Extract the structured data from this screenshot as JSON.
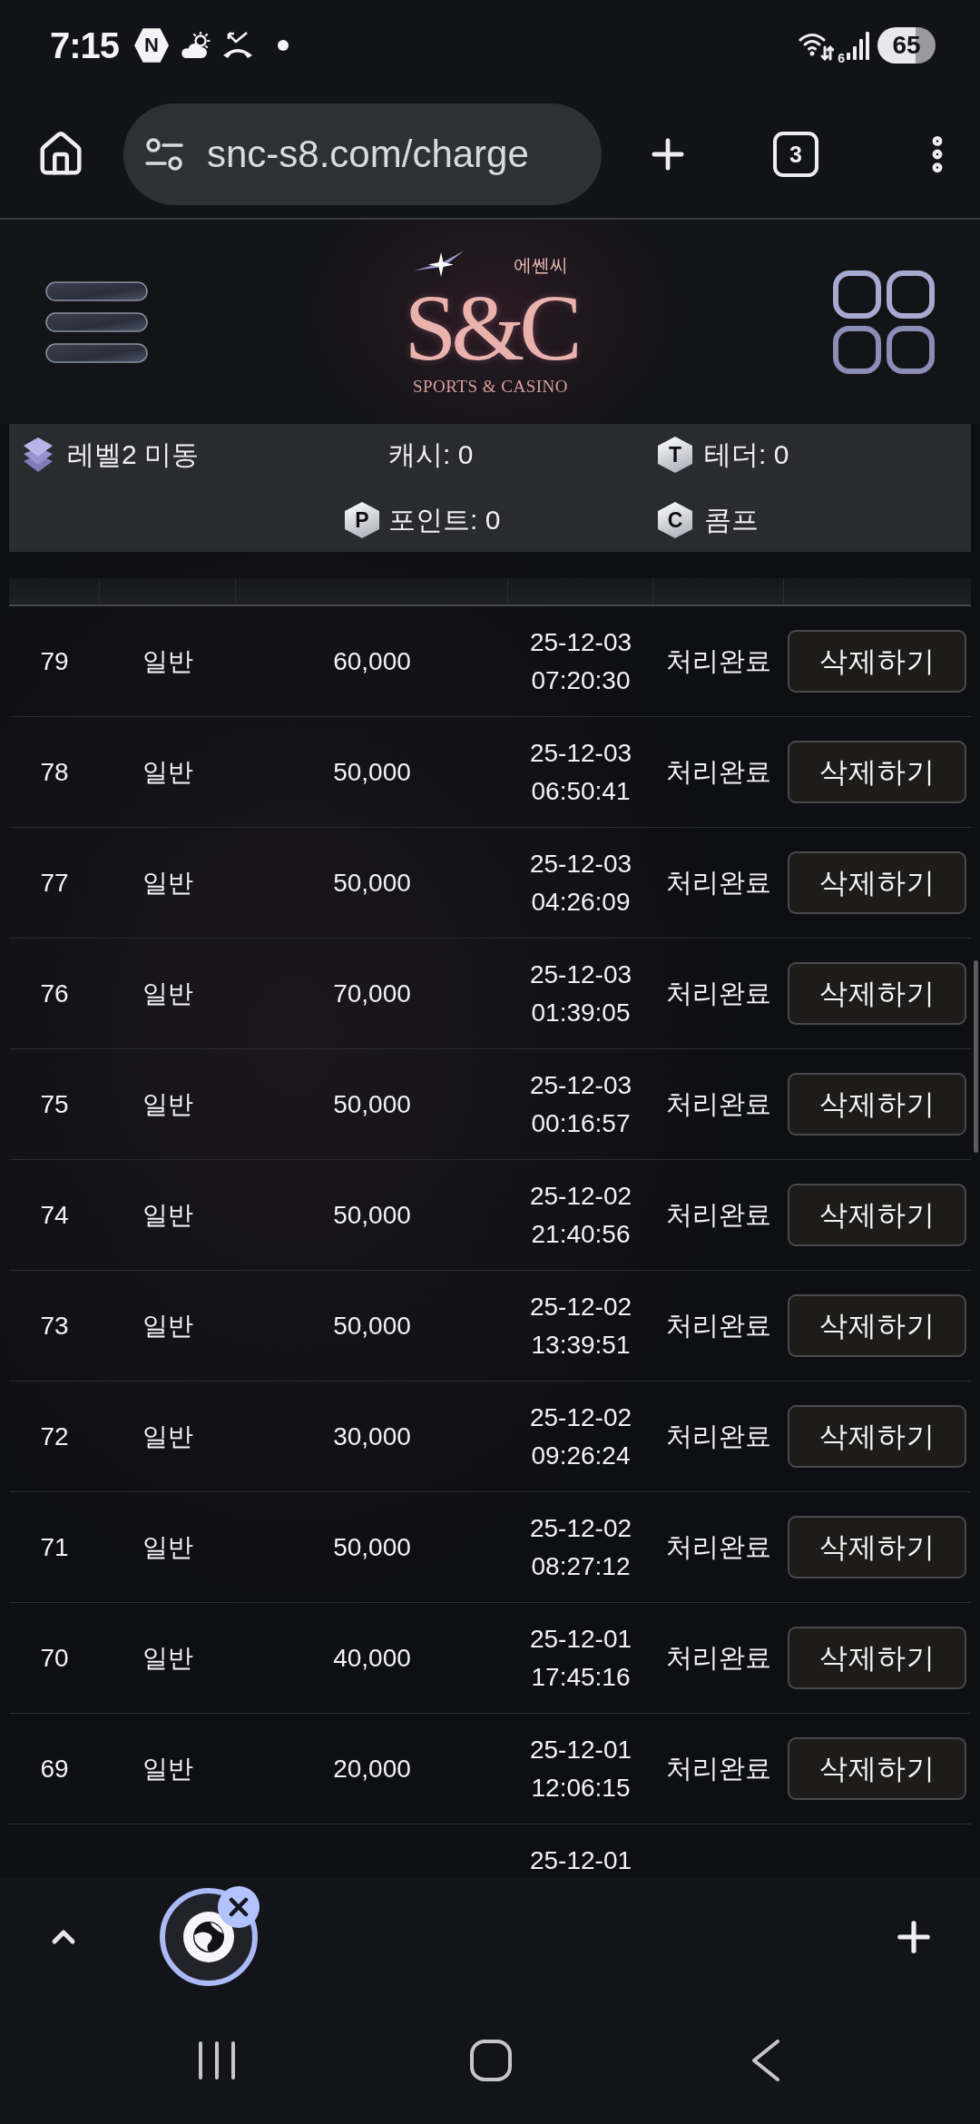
{
  "status_bar": {
    "time": "7:15",
    "app_badge": "N",
    "wifi_label": "6",
    "battery": "65"
  },
  "browser_bar": {
    "url": "snc-s8.com/charge",
    "tab_count": "3"
  },
  "site_header": {
    "logo": {
      "mark": "S&C",
      "native_name": "에쎈씨",
      "tagline": "SPORTS & CASINO"
    }
  },
  "account_bar": {
    "level": {
      "label": "레벨2 미동"
    },
    "cash": {
      "label": "캐시: 0"
    },
    "tether": {
      "badge": "T",
      "label": "테더: 0"
    },
    "points": {
      "badge": "P",
      "label": "포인트: 0"
    },
    "comp": {
      "badge": "C",
      "label": "콤프"
    }
  },
  "table": {
    "rows": [
      {
        "number": "79",
        "type": "일반",
        "amount": "60,000",
        "date": "25-12-03",
        "time": "07:20:30",
        "status": "처리완료",
        "action": "삭제하기"
      },
      {
        "number": "78",
        "type": "일반",
        "amount": "50,000",
        "date": "25-12-03",
        "time": "06:50:41",
        "status": "처리완료",
        "action": "삭제하기"
      },
      {
        "number": "77",
        "type": "일반",
        "amount": "50,000",
        "date": "25-12-03",
        "time": "04:26:09",
        "status": "처리완료",
        "action": "삭제하기"
      },
      {
        "number": "76",
        "type": "일반",
        "amount": "70,000",
        "date": "25-12-03",
        "time": "01:39:05",
        "status": "처리완료",
        "action": "삭제하기"
      },
      {
        "number": "75",
        "type": "일반",
        "amount": "50,000",
        "date": "25-12-03",
        "time": "00:16:57",
        "status": "처리완료",
        "action": "삭제하기"
      },
      {
        "number": "74",
        "type": "일반",
        "amount": "50,000",
        "date": "25-12-02",
        "time": "21:40:56",
        "status": "처리완료",
        "action": "삭제하기"
      },
      {
        "number": "73",
        "type": "일반",
        "amount": "50,000",
        "date": "25-12-02",
        "time": "13:39:51",
        "status": "처리완료",
        "action": "삭제하기"
      },
      {
        "number": "72",
        "type": "일반",
        "amount": "30,000",
        "date": "25-12-02",
        "time": "09:26:24",
        "status": "처리완료",
        "action": "삭제하기"
      },
      {
        "number": "71",
        "type": "일반",
        "amount": "50,000",
        "date": "25-12-02",
        "time": "08:27:12",
        "status": "처리완료",
        "action": "삭제하기"
      },
      {
        "number": "70",
        "type": "일반",
        "amount": "40,000",
        "date": "25-12-01",
        "time": "17:45:16",
        "status": "처리완료",
        "action": "삭제하기"
      },
      {
        "number": "69",
        "type": "일반",
        "amount": "20,000",
        "date": "25-12-01",
        "time": "12:06:15",
        "status": "처리완료",
        "action": "삭제하기"
      },
      {
        "date": "25-12-01"
      }
    ]
  }
}
